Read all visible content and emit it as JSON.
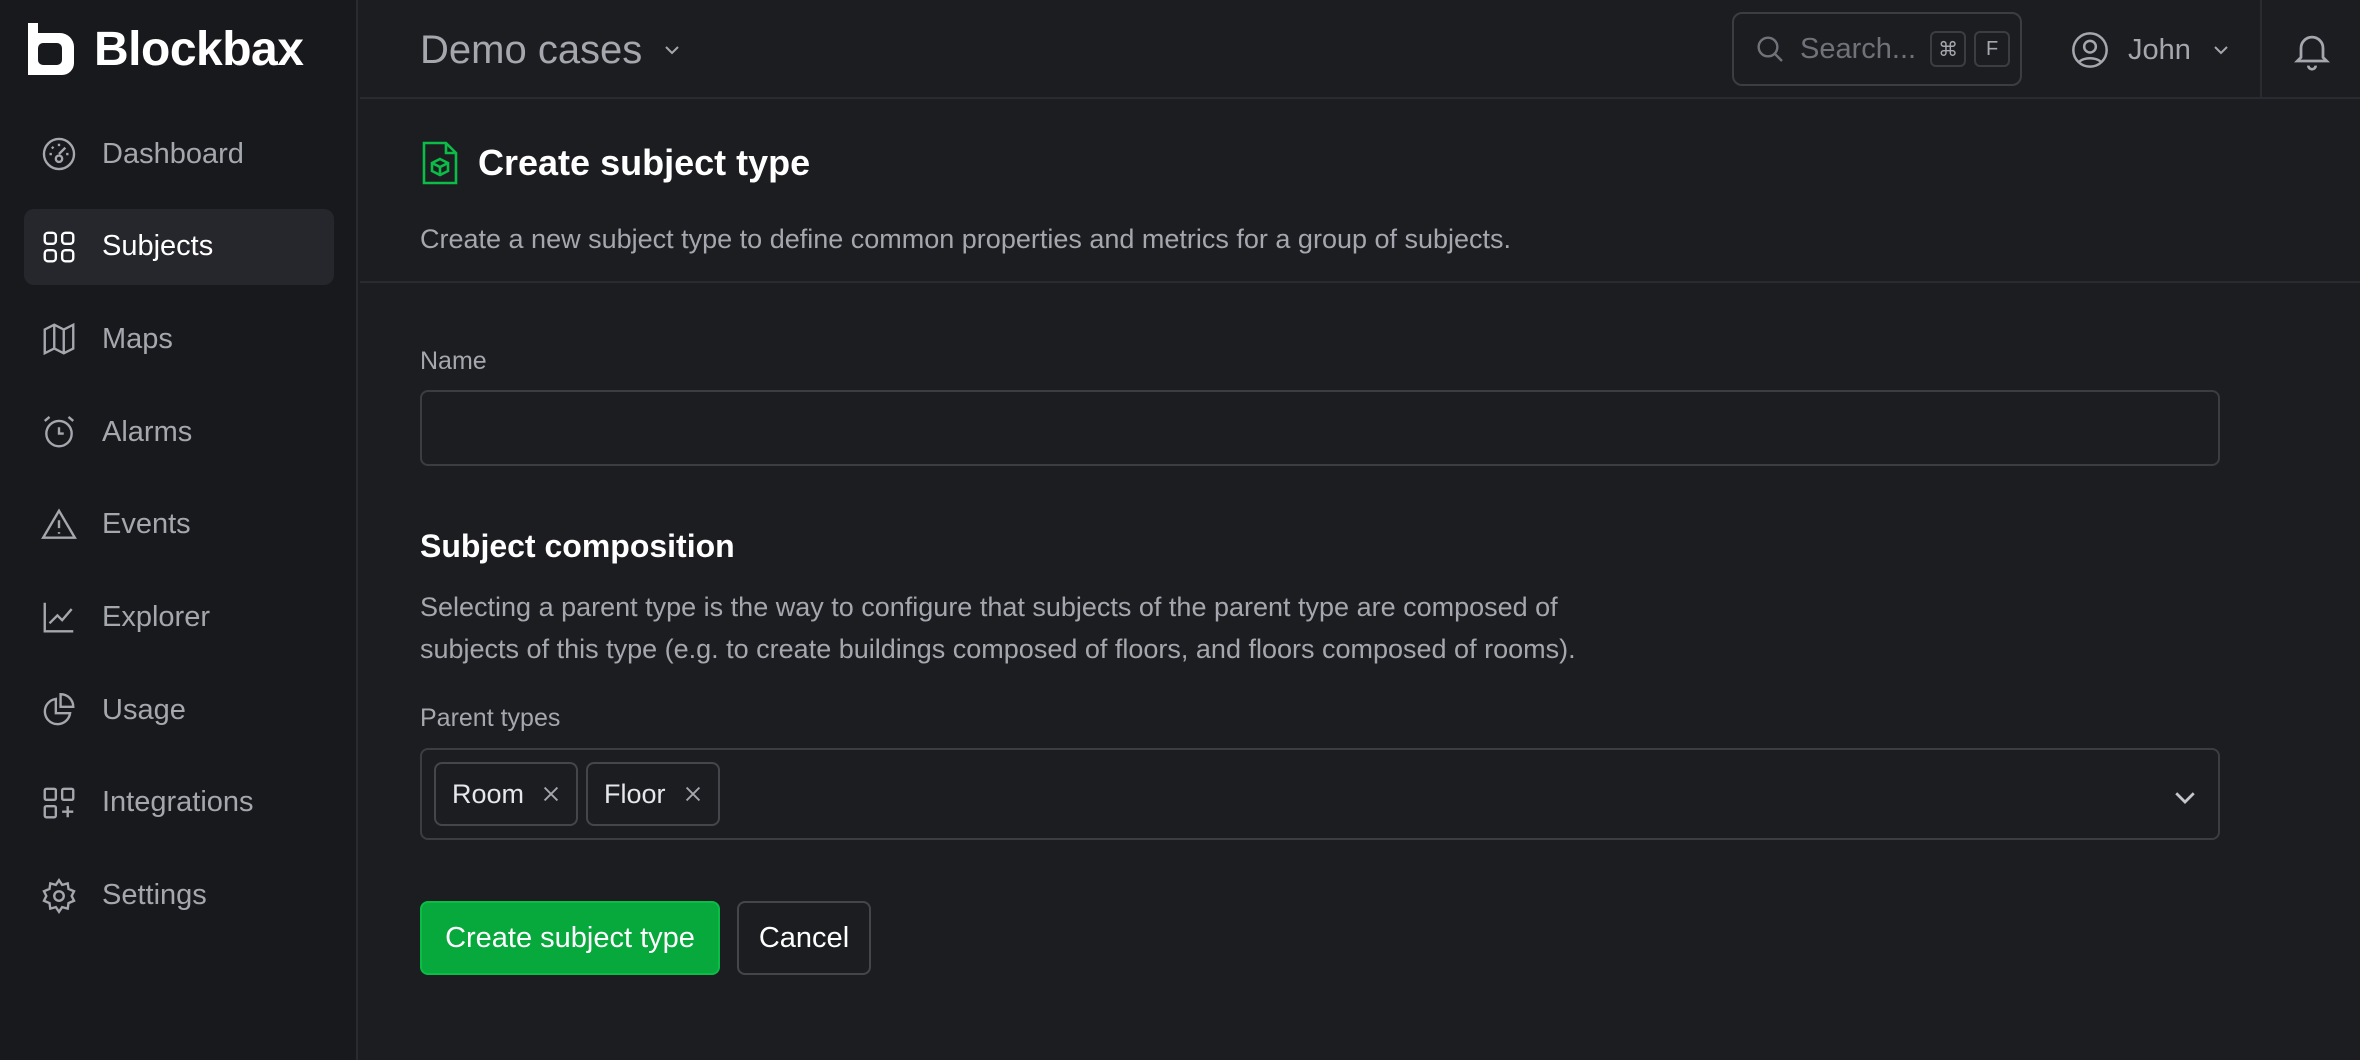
{
  "app": {
    "name": "Blockbax"
  },
  "sidebar": {
    "items": [
      {
        "label": "Dashboard",
        "icon": "dashboard-icon"
      },
      {
        "label": "Subjects",
        "icon": "grid-icon",
        "active": true
      },
      {
        "label": "Maps",
        "icon": "map-icon"
      },
      {
        "label": "Alarms",
        "icon": "alarm-clock-icon"
      },
      {
        "label": "Events",
        "icon": "warning-icon"
      },
      {
        "label": "Explorer",
        "icon": "line-chart-icon"
      },
      {
        "label": "Usage",
        "icon": "pie-chart-icon"
      },
      {
        "label": "Integrations",
        "icon": "integrations-icon"
      },
      {
        "label": "Settings",
        "icon": "gear-icon"
      }
    ]
  },
  "header": {
    "workspace": "Demo cases",
    "search_placeholder": "Search...",
    "search_shortcut": [
      "⌘",
      "F"
    ],
    "user_name": "John"
  },
  "page": {
    "title": "Create subject type",
    "description": "Create a new subject type to define common properties and metrics for a group of subjects.",
    "name_label": "Name",
    "name_value": "",
    "composition_title": "Subject composition",
    "composition_desc_line1": "Selecting a parent type is the way to configure that subjects of the parent type are composed of",
    "composition_desc_line2": "subjects of this type (e.g. to create buildings composed of floors, and floors composed of rooms).",
    "parent_types_label": "Parent types",
    "parent_types": [
      "Room",
      "Floor"
    ],
    "create_button": "Create subject type",
    "cancel_button": "Cancel"
  },
  "colors": {
    "background": "#1c1d21",
    "sidebar": "#18191c",
    "accent": "#07a83c"
  }
}
